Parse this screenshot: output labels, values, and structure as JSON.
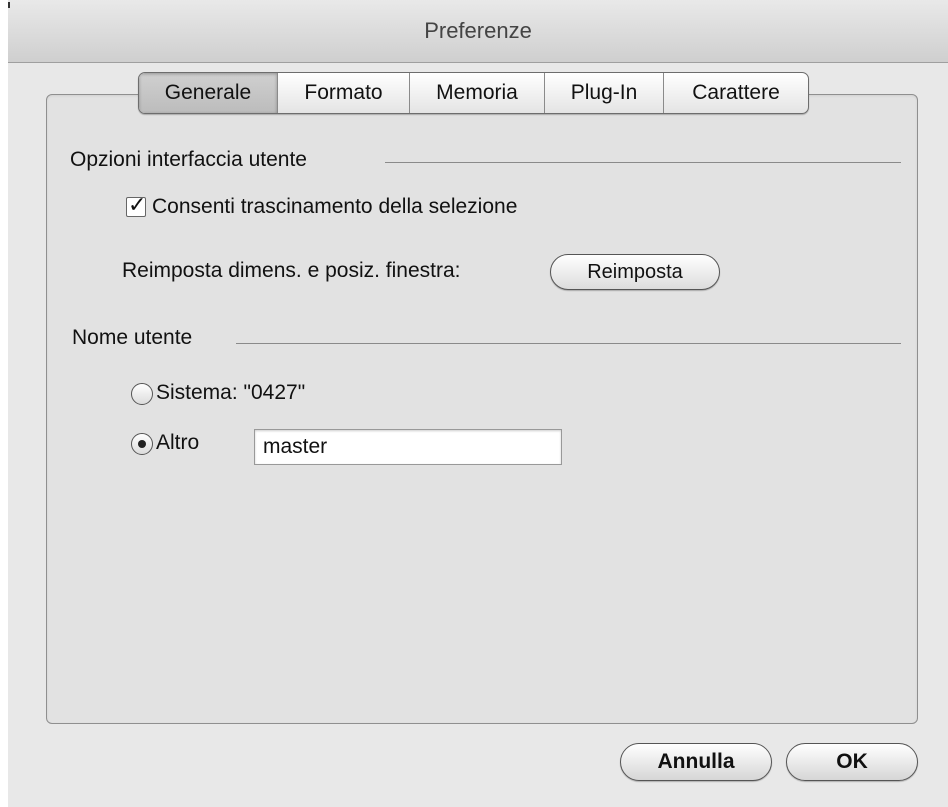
{
  "window": {
    "title": "Preferenze"
  },
  "tabs": [
    {
      "label": "Generale",
      "selected": true
    },
    {
      "label": "Formato",
      "selected": false
    },
    {
      "label": "Memoria",
      "selected": false
    },
    {
      "label": "Plug-In",
      "selected": false
    },
    {
      "label": "Carattere",
      "selected": false
    }
  ],
  "ui_options": {
    "heading": "Opzioni interfaccia utente",
    "allow_drag": {
      "label": "Consenti trascinamento della selezione",
      "checked": true
    },
    "reset_window": {
      "label": "Reimposta dimens. e posiz. finestra:",
      "button_label": "Reimposta"
    }
  },
  "user_name": {
    "heading": "Nome utente",
    "system_option": {
      "label": "Sistema: \"0427\"",
      "selected": false
    },
    "other_option": {
      "label": "Altro",
      "selected": true,
      "value": "master"
    }
  },
  "footer": {
    "cancel_label": "Annulla",
    "ok_label": "OK"
  },
  "colors": {
    "window_bg": "#e8e8e8",
    "panel_bg": "#e2e2e2",
    "selected_tab": "#c6c6c6"
  }
}
